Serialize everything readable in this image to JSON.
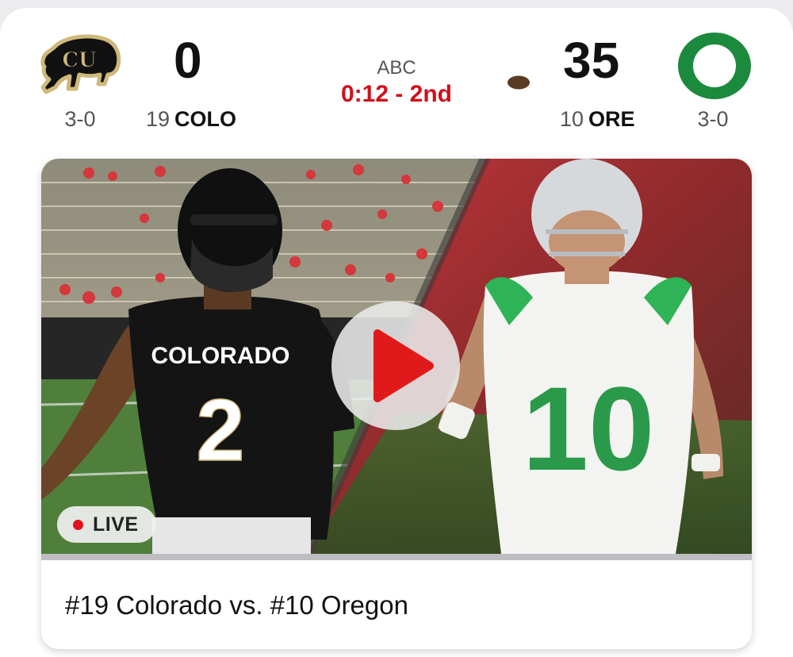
{
  "scoreboard": {
    "away": {
      "record": "3-0",
      "score": "0",
      "rank": "19",
      "abbr": "COLO",
      "logo_icon": "colorado-buffalo-logo-icon",
      "colors": {
        "primary": "#000000",
        "secondary": "#cfb87c"
      }
    },
    "home": {
      "record": "3-0",
      "score": "35",
      "rank": "10",
      "abbr": "ORE",
      "logo_icon": "oregon-o-logo-icon",
      "colors": {
        "primary": "#1b8a3c"
      }
    },
    "network": "ABC",
    "clock": "0:12 - 2nd",
    "possession_icon": "football-icon",
    "clock_color": "#d0101c"
  },
  "video": {
    "thumbnail_description_icon": "video-thumbnail",
    "away_jersey_number": "2",
    "away_jersey_text": "COLORADO",
    "home_jersey_number": "10",
    "live_label": "LIVE",
    "live_color": "#e0121f",
    "play_icon": "play-icon",
    "title": "#19 Colorado vs. #10 Oregon"
  }
}
